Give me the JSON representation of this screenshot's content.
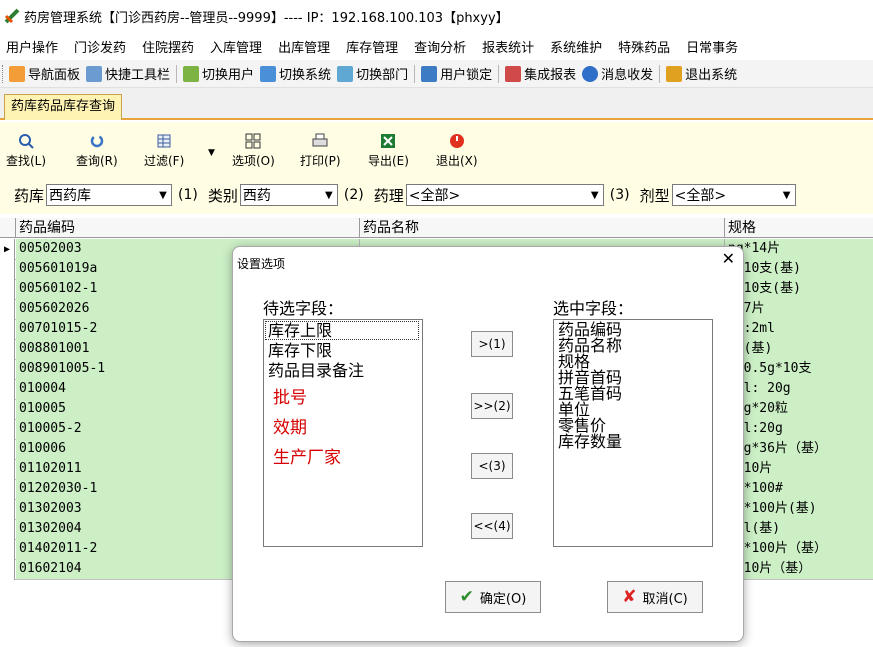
{
  "window": {
    "title": "药房管理系统【门诊西药房--管理员--9999】---- IP：192.168.100.103【phxyy】"
  },
  "menubar": {
    "items": [
      "用户操作",
      "门诊发药",
      "住院摆药",
      "入库管理",
      "出库管理",
      "库存管理",
      "查询分析",
      "报表统计",
      "系统维护",
      "特殊药品",
      "日常事务"
    ]
  },
  "quickbar": {
    "items": [
      "导航面板",
      "快捷工具栏",
      "切换用户",
      "切换系统",
      "切换部门",
      "用户锁定",
      "集成报表",
      "消息收发",
      "退出系统"
    ]
  },
  "tab": {
    "label": "药库药品库存查询"
  },
  "toolbar": {
    "find": "查找(L)",
    "query": "查询(R)",
    "filter": "过滤(F)",
    "options": "选项(O)",
    "print": "打印(P)",
    "export": "导出(E)",
    "exit": "退出(X)"
  },
  "filters": {
    "store_label": "药库",
    "store_value": "西药库",
    "store_hint": "(1)",
    "category_label": "类别",
    "category_value": "西药",
    "category_hint": "(2)",
    "pharma_label": "药理",
    "pharma_value": "<全部>",
    "pharma_hint": "(3)",
    "form_label": "剂型",
    "form_value": "<全部>"
  },
  "grid": {
    "columns": [
      "药品编码",
      "药品名称",
      "规格"
    ],
    "rows": [
      {
        "code": "00502003",
        "name": "",
        "spec": "ng*14片"
      },
      {
        "code": "005601019a",
        "name": "",
        "spec": "g*10支(基)"
      },
      {
        "code": "00560102-1",
        "name": "",
        "spec": "g*10支(基)"
      },
      {
        "code": "005602026",
        "name": "",
        "spec": "g*7片"
      },
      {
        "code": "00701015-2",
        "name": "",
        "spec": "ng:2ml"
      },
      {
        "code": "008801001",
        "name": "",
        "spec": "0U(基)"
      },
      {
        "code": "008901005-1",
        "name": "",
        "spec": "1:0.5g*10支"
      },
      {
        "code": "010004",
        "name": "",
        "spec": "0ml: 20g"
      },
      {
        "code": "010005",
        "name": "",
        "spec": "15g*20粒"
      },
      {
        "code": "010005-2",
        "name": "",
        "spec": "0ml:20g"
      },
      {
        "code": "010006",
        "name": "",
        "spec": "45g*36片（基）"
      },
      {
        "code": "01102011",
        "name": "",
        "spec": "g*10片"
      },
      {
        "code": "01202030-1",
        "name": "",
        "spec": "2g*100#"
      },
      {
        "code": "01302003",
        "name": "",
        "spec": "ng*100片(基)"
      },
      {
        "code": "01302004",
        "name": "",
        "spec": "0ml(基)"
      },
      {
        "code": "01402011-2",
        "name": "",
        "spec": "ng*100片（基）"
      },
      {
        "code": "01602104",
        "name": "",
        "spec": "g*10片（基）"
      }
    ]
  },
  "dialog": {
    "title": "设置选项",
    "available_label": "待选字段：",
    "selected_label": "选中字段：",
    "available_items": [
      {
        "text": "库存上限",
        "red": false
      },
      {
        "text": "库存下限",
        "red": false
      },
      {
        "text": "药品目录备注",
        "red": false
      },
      {
        "text": "批号",
        "red": true
      },
      {
        "text": "效期",
        "red": true
      },
      {
        "text": "生产厂家",
        "red": true
      }
    ],
    "selected_items": [
      "药品编码",
      "药品名称",
      "规格",
      "拼音首码",
      "五笔首码",
      "单位",
      "零售价",
      "库存数量"
    ],
    "btn_add": ">(1)",
    "btn_add_all": ">>(2)",
    "btn_remove": "<(3)",
    "btn_remove_all": "<<(4)",
    "ok": "确定(O)",
    "cancel": "取消(C)"
  },
  "colors": {
    "grid_row": "#ccefc6",
    "toolbar_bg": "#fffde4",
    "tab_accent": "#e8a33c",
    "red_text": "#d60000"
  }
}
